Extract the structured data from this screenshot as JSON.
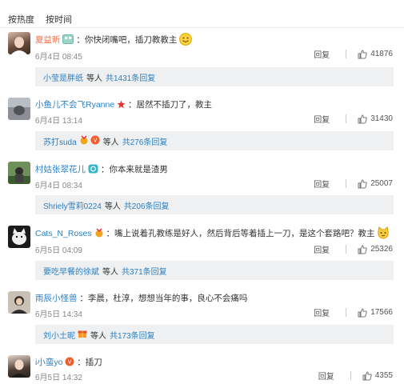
{
  "tabs": {
    "hot": "按热度",
    "time": "按时间"
  },
  "comments": [
    {
      "user": "夏益昕",
      "text": "：你快闭嘴吧，插刀教教主",
      "time": "6月4日 08:45",
      "reply": "回复",
      "likes": "41876",
      "sub": {
        "who": "小莹是胖纸",
        "mid": "等人",
        "total": "共1431条回复"
      }
    },
    {
      "user": "小鱼儿不会飞Ryanne",
      "text": "：居然不插刀了，教主",
      "time": "6月4日 13:14",
      "reply": "回复",
      "likes": "31430",
      "sub": {
        "who": "苏打suda",
        "mid": "等人",
        "total": "共276条回复"
      }
    },
    {
      "user": "村姑张翠花儿",
      "text": "：你本来就是渣男",
      "time": "6月4日 08:34",
      "reply": "回复",
      "likes": "25007",
      "sub": {
        "who": "Shriely雪莉0224",
        "mid": "等人",
        "total": "共206条回复"
      }
    },
    {
      "user": "Cats_N_Roses",
      "text": "：嘴上说着孔教练是好人，然后背后等着插上一刀，是这个套路吧？教主",
      "time": "6月5日 04:09",
      "reply": "回复",
      "likes": "25326",
      "sub": {
        "who": "要吃早餐的徐斌",
        "mid": "等人",
        "total": "共371条回复"
      }
    },
    {
      "user": "雨辰小怪兽",
      "text": "：李晨，杜淳，想想当年的事，良心不会痛吗",
      "time": "6月5日 14:34",
      "reply": "回复",
      "likes": "17566",
      "sub": {
        "who": "刘小土昵",
        "mid": "等人",
        "total": "共173条回复"
      }
    },
    {
      "user": "i小蛮yo",
      "text": "：插刀",
      "time": "6月5日 14:32",
      "reply": "回复",
      "likes": "4355"
    }
  ],
  "colors": {
    "username": "#eb7350",
    "link": "#2a7fc4",
    "subBg": "#eff0f1"
  }
}
